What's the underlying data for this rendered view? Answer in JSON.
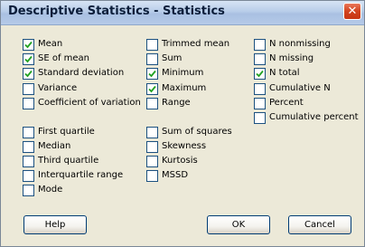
{
  "window": {
    "title": "Descriptive Statistics - Statistics",
    "close_symbol": "✕"
  },
  "options": {
    "mean": {
      "label": "Mean",
      "checked": true
    },
    "se_of_mean": {
      "label": "SE of mean",
      "checked": true
    },
    "standard_deviation": {
      "label": "Standard deviation",
      "checked": true
    },
    "variance": {
      "label": "Variance",
      "checked": false
    },
    "coefficient_of_variation": {
      "label": "Coefficient of variation",
      "checked": false
    },
    "first_quartile": {
      "label": "First quartile",
      "checked": false
    },
    "median": {
      "label": "Median",
      "checked": false
    },
    "third_quartile": {
      "label": "Third quartile",
      "checked": false
    },
    "interquartile_range": {
      "label": "Interquartile range",
      "checked": false
    },
    "mode": {
      "label": "Mode",
      "checked": false
    },
    "trimmed_mean": {
      "label": "Trimmed mean",
      "checked": false
    },
    "sum": {
      "label": "Sum",
      "checked": false
    },
    "minimum": {
      "label": "Minimum",
      "checked": true
    },
    "maximum": {
      "label": "Maximum",
      "checked": true
    },
    "range": {
      "label": "Range",
      "checked": false
    },
    "sum_of_squares": {
      "label": "Sum of squares",
      "checked": false
    },
    "skewness": {
      "label": "Skewness",
      "checked": false
    },
    "kurtosis": {
      "label": "Kurtosis",
      "checked": false
    },
    "mssd": {
      "label": "MSSD",
      "checked": false
    },
    "n_nonmissing": {
      "label": "N nonmissing",
      "checked": false
    },
    "n_missing": {
      "label": "N missing",
      "checked": false
    },
    "n_total": {
      "label": "N total",
      "checked": true
    },
    "cumulative_n": {
      "label": "Cumulative N",
      "checked": false
    },
    "percent": {
      "label": "Percent",
      "checked": false
    },
    "cumulative_percent": {
      "label": "Cumulative percent",
      "checked": false
    }
  },
  "buttons": {
    "help": "Help",
    "ok": "OK",
    "cancel": "Cancel"
  },
  "colors": {
    "dialog_background": "#ECE9D8",
    "checkbox_border": "#1C5180",
    "checkmark": "#21A121"
  }
}
